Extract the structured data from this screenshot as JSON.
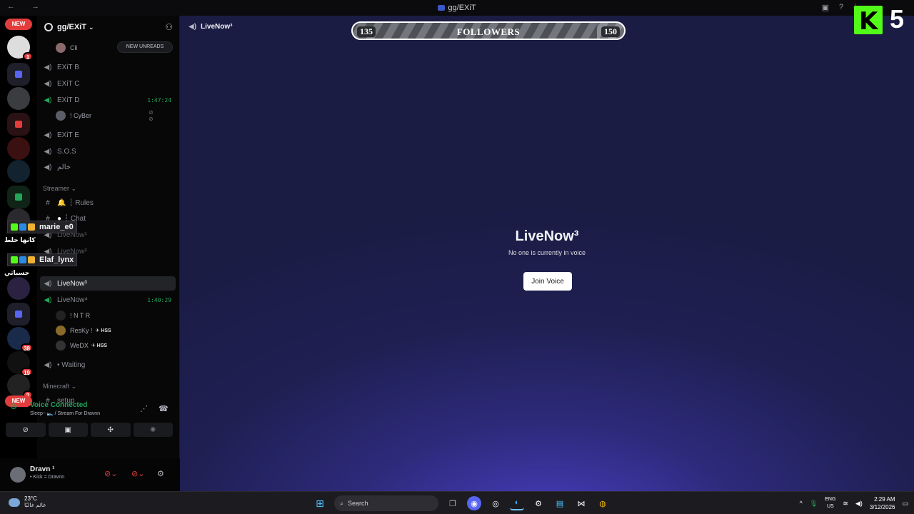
{
  "window": {
    "title": "gg/EXiT",
    "nav": "← →"
  },
  "server": {
    "name": "gg/EXiT",
    "new_unreads": "NEW UNREADS"
  },
  "rail": {
    "new_badge_top": "NEW",
    "new_badge_bottom": "NEW",
    "counts": [
      "1",
      "38",
      "19",
      "3"
    ]
  },
  "channels": [
    {
      "name": "EXiT B",
      "kind": "voice"
    },
    {
      "name": "EXiT C",
      "kind": "voice"
    },
    {
      "name": "EXiT D",
      "kind": "voice",
      "time": "1:47:24"
    },
    {
      "name": "EXiT E",
      "kind": "voice"
    },
    {
      "name": "S.O.S",
      "kind": "voice"
    },
    {
      "name": "خالم",
      "kind": "voice"
    }
  ],
  "users_top": [
    {
      "name": "Cli"
    },
    {
      "name": "! CyBer"
    }
  ],
  "category_streamer": "Streamer",
  "streamer_channels": [
    {
      "name": "┆ Rules",
      "kind": "text"
    },
    {
      "name": "┆ Chat",
      "kind": "text"
    },
    {
      "name": "LiveNow¹",
      "kind": "voice"
    },
    {
      "name": "LiveNow²",
      "kind": "voice"
    },
    {
      "name": "LiveNow³",
      "kind": "voice"
    },
    {
      "name": "LiveNow⁴",
      "kind": "voice",
      "time": "1:40:29"
    }
  ],
  "live4_users": [
    {
      "name": "! N T R",
      "tag": ""
    },
    {
      "name": "ResKy !",
      "tag": "HSS"
    },
    {
      "name": "WeDX",
      "tag": "HSS"
    }
  ],
  "waiting": "• Waiting",
  "category_minecraft": "Minecraft",
  "setup": "setup",
  "overlay": {
    "name1": "marie_e0",
    "arabic1": "كانها خلط",
    "name2": "Elaf_lynx",
    "arabic2": "حسباتي"
  },
  "voice": {
    "status": "Voice Connected",
    "sub": "Sleep~ 🛌 / Stream For Dravnn"
  },
  "user": {
    "name": "Dravn ¹",
    "status": "• Kick = Dravnn"
  },
  "main": {
    "channel_title": "LiveNow³",
    "heading": "LiveNow³",
    "empty_text": "No one is currently in voice",
    "join_button": "Join Voice"
  },
  "followers": {
    "label": "FOLLOWERS",
    "current": "135",
    "goal": "150",
    "progress": 0.9
  },
  "kick": {
    "logo_letter": "K",
    "number": "5",
    "color": "#53fc18"
  },
  "taskbar": {
    "temp": "23°C",
    "weather_text": "غائم غالبًا",
    "search": "Search",
    "lang_top": "ENG",
    "lang_bottom": "US",
    "time": "2:29 AM",
    "date": "3/12/2026"
  },
  "colors": {
    "accent_green": "#23a55a",
    "alert_red": "#e23c3c",
    "join_bg": "#ffffff"
  }
}
